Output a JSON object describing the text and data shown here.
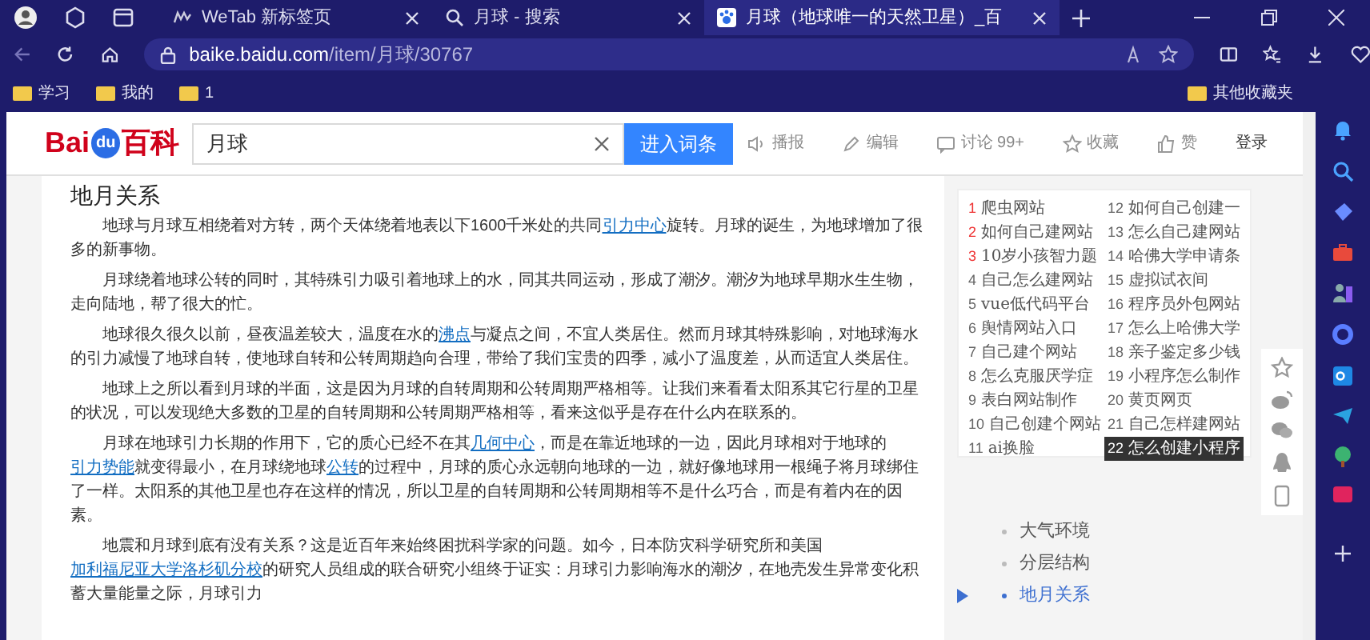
{
  "browser": {
    "tabs": [
      {
        "title": "WeTab 新标签页",
        "selected": false
      },
      {
        "title": "月球 - 搜索",
        "selected": false
      },
      {
        "title": "月球（地球唯一的天然卫星）_百",
        "selected": true
      }
    ],
    "address": {
      "host": "baike.baidu.com",
      "path": "/item/月球/30767"
    },
    "bookmarks": [
      "学习",
      "我的",
      "1"
    ],
    "other_bookmarks": "其他收藏夹"
  },
  "header": {
    "logo_latin": "Bai",
    "logo_du": "du",
    "logo_cn": "百科",
    "search_value": "月球",
    "search_button": "进入词条",
    "actions": [
      {
        "kind": "speaker",
        "label": "播报"
      },
      {
        "kind": "pencil",
        "label": "编辑"
      },
      {
        "kind": "chat",
        "label": "讨论 99+"
      },
      {
        "kind": "star",
        "label": "收藏"
      },
      {
        "kind": "thumb",
        "label": "赞"
      }
    ],
    "login": "登录"
  },
  "article": {
    "heading": "地月关系",
    "paragraphs": [
      [
        {
          "text": "地球与月球互相绕着对方转，两个天体绕着地表以下1600千米处的共同",
          "link": false
        },
        {
          "text": "引力中心",
          "link": true
        },
        {
          "text": "旋转。月球的诞生，为地球增加了很多的新事物。",
          "link": false
        }
      ],
      [
        {
          "text": "月球绕着地球公转的同时，其特殊引力吸引着地球上的水，同其共同运动，形成了潮汐。潮汐为地球早期水生生物，走向陆地，帮了很大的忙。",
          "link": false
        }
      ],
      [
        {
          "text": "地球很久很久以前，昼夜温差较大，温度在水的",
          "link": false
        },
        {
          "text": "沸点",
          "link": true
        },
        {
          "text": "与凝点之间，不宜人类居住。然而月球其特殊影响，对地球海水的引力减慢了地球自转，使地球自转和公转周期趋向合理，带给了我们宝贵的四季，减小了温度差，从而适宜人类居住。",
          "link": false
        }
      ],
      [
        {
          "text": "地球上之所以看到月球的半面，这是因为月球的自转周期和公转周期严格相等。让我们来看看太阳系其它行星的卫星的状况，可以发现绝大多数的卫星的自转周期和公转周期严格相等，看来这似乎是存在什么内在联系的。",
          "link": false
        }
      ],
      [
        {
          "text": "月球在地球引力长期的作用下，它的质心已经不在其",
          "link": false
        },
        {
          "text": "几何中心",
          "link": true
        },
        {
          "text": "，而是在靠近地球的一边，因此月球相对于地球的",
          "link": false
        },
        {
          "text": "引力势能",
          "link": true
        },
        {
          "text": "就变得最小，在月球绕地球",
          "link": false
        },
        {
          "text": "公转",
          "link": true
        },
        {
          "text": "的过程中，月球的质心永远朝向地球的一边，就好像地球用一根绳子将月球绑住了一样。太阳系的其他卫星也存在这样的情况，所以卫星的自转周期和公转周期相等不是什么巧合，而是有着内在的因素。",
          "link": false
        }
      ],
      [
        {
          "text": "地震和月球到底有没有关系？这是近百年来始终困扰科学家的问题。如今，日本防灾科学研究所和美国",
          "link": false
        },
        {
          "text": "加利福尼亚大学洛杉矶分校",
          "link": true
        },
        {
          "text": "的研究人员组成的联合研究小组终于证实：月球引力影响海水的潮汐，在地壳发生异常变化积蓄大量能量之际，月球引力",
          "link": false
        }
      ]
    ]
  },
  "hot_list": [
    {
      "rank": "1",
      "text": "爬虫网站",
      "top": true,
      "selected": false
    },
    {
      "rank": "2",
      "text": "如何自己建网站",
      "top": true,
      "selected": false
    },
    {
      "rank": "3",
      "text": "10岁小孩智力题",
      "top": true,
      "selected": false
    },
    {
      "rank": "4",
      "text": "自己怎么建网站",
      "top": false,
      "selected": false
    },
    {
      "rank": "5",
      "text": "vue低代码平台",
      "top": false,
      "selected": false
    },
    {
      "rank": "6",
      "text": "舆情网站入口",
      "top": false,
      "selected": false
    },
    {
      "rank": "7",
      "text": "自己建个网站",
      "top": false,
      "selected": false
    },
    {
      "rank": "8",
      "text": "怎么克服厌学症",
      "top": false,
      "selected": false
    },
    {
      "rank": "9",
      "text": "表白网站制作",
      "top": false,
      "selected": false
    },
    {
      "rank": "10",
      "text": "自己创建个网站",
      "top": false,
      "selected": false
    },
    {
      "rank": "11",
      "text": "ai换脸",
      "top": false,
      "selected": false
    },
    {
      "rank": "12",
      "text": "如何自己创建一",
      "top": false,
      "selected": false
    },
    {
      "rank": "13",
      "text": "怎么自己建网站",
      "top": false,
      "selected": false
    },
    {
      "rank": "14",
      "text": "哈佛大学申请条",
      "top": false,
      "selected": false
    },
    {
      "rank": "15",
      "text": "虚拟试衣间",
      "top": false,
      "selected": false
    },
    {
      "rank": "16",
      "text": "程序员外包网站",
      "top": false,
      "selected": false
    },
    {
      "rank": "17",
      "text": "怎么上哈佛大学",
      "top": false,
      "selected": false
    },
    {
      "rank": "18",
      "text": "亲子鉴定多少钱",
      "top": false,
      "selected": false
    },
    {
      "rank": "19",
      "text": "小程序怎么制作",
      "top": false,
      "selected": false
    },
    {
      "rank": "20",
      "text": "黄页网页",
      "top": false,
      "selected": false
    },
    {
      "rank": "21",
      "text": "自己怎样建网站",
      "top": false,
      "selected": false
    },
    {
      "rank": "22",
      "text": "怎么创建小程序",
      "top": false,
      "selected": true
    }
  ],
  "toc": [
    {
      "label": "大气环境",
      "selected": false
    },
    {
      "label": "分层结构",
      "selected": false
    },
    {
      "label": "地月关系",
      "selected": true
    }
  ]
}
